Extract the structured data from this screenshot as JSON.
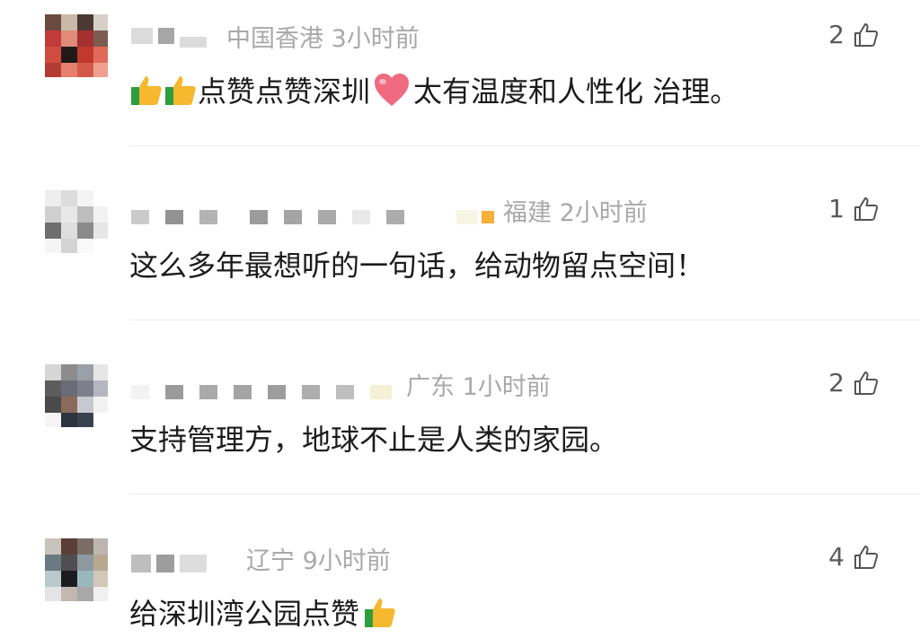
{
  "comments": [
    {
      "region_time": "中国香港 3小时前",
      "likes": "2",
      "text": "点赞点赞深圳",
      "text_after": "太有温度和人性化 治理。"
    },
    {
      "region_time": "福建 2小时前",
      "likes": "1",
      "text": "这么多年最想听的一句话，给动物留点空间！"
    },
    {
      "region_time": "广东 1小时前",
      "likes": "2",
      "text": "支持管理方，地球不止是人类的家园。"
    },
    {
      "region_time": "辽宁 9小时前",
      "likes": "4",
      "text": "给深圳湾公园点赞"
    }
  ],
  "icons": {
    "like": "thumbs-up-outline-icon",
    "emoji_thumb": "thumbs-up-emoji",
    "emoji_heart": "heart-emoji"
  },
  "colors": {
    "meta_text": "#a9a9a9",
    "body_text": "#1c1c1c",
    "divider": "#ededed"
  }
}
